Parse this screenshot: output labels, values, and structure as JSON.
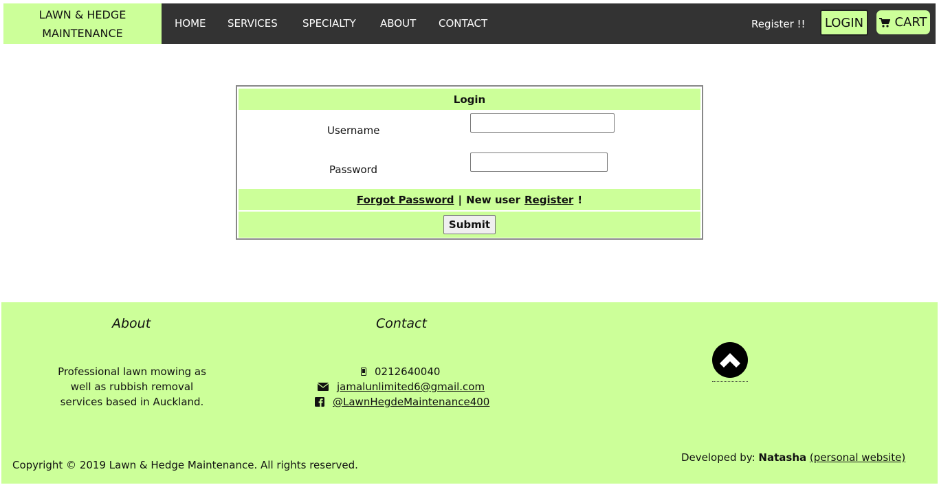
{
  "header": {
    "brand_line1": "LAWN & HEDGE",
    "brand_line2": "MAINTENANCE",
    "nav": [
      "HOME",
      "SERVICES",
      "SPECIALTY",
      "ABOUT",
      "CONTACT"
    ],
    "register": "Register !!",
    "login": "LOGIN",
    "cart": "CART"
  },
  "login_form": {
    "title": "Login",
    "username_label": "Username",
    "password_label": "Password",
    "username_value": "",
    "password_value": "",
    "forgot_password": "Forgot Password",
    "separator": "|",
    "new_user_text": "New user",
    "register_link": "Register",
    "exclaim": "!",
    "submit": "Submit"
  },
  "footer": {
    "about_heading": "About",
    "about_text": "Professional lawn mowing as well as rubbish removal services based in Auckland.",
    "contact_heading": "Contact",
    "phone": "0212640040",
    "email": "jamalunlimited6@gmail.com",
    "facebook": "@LawnHegdeMaintenance400",
    "copyright": "Copyright © 2019 Lawn & Hedge Maintenance. All rights reserved.",
    "developed_by": "Developed by:",
    "developer": "Natasha",
    "personal_site": "(personal website)"
  },
  "colors": {
    "accent": "#ccff99",
    "nav_bg": "#333333"
  }
}
